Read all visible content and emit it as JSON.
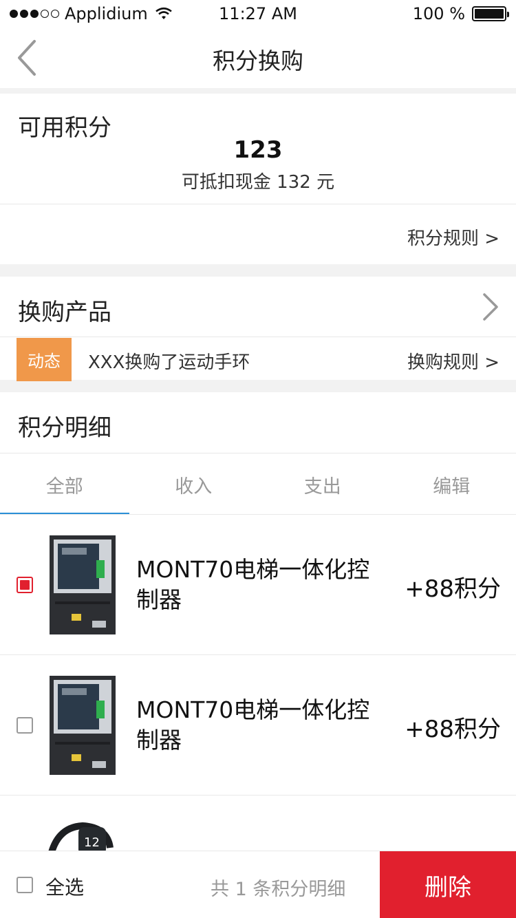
{
  "status_bar": {
    "carrier": "Applidium",
    "time": "11:27 AM",
    "battery": "100 %"
  },
  "nav": {
    "title": "积分换购"
  },
  "points": {
    "label": "可用积分",
    "value": "123",
    "cash_text": "可抵扣现金 132 元",
    "rules_link": "积分规则 >"
  },
  "exchange": {
    "title": "换购产品",
    "feed_badge": "动态",
    "feed_text": "XXX换购了运动手环",
    "rules_link": "换购规则 >"
  },
  "detail": {
    "title": "积分明细",
    "tabs": [
      {
        "label": "全部"
      },
      {
        "label": "收入"
      },
      {
        "label": "支出"
      },
      {
        "label": "编辑"
      }
    ]
  },
  "list": [
    {
      "name": "MONT70电梯一体化控制器",
      "points": "+88积分",
      "checked": true
    },
    {
      "name": "MONT70电梯一体化控制器",
      "points": "+88积分",
      "checked": false
    }
  ],
  "bottom_bar": {
    "select_all": "全选",
    "total_text": "共 1 条积分明细",
    "delete_label": "删除"
  },
  "colors": {
    "accent_red": "#e1202e",
    "badge_orange": "#f0984a",
    "tab_underline": "#2a8fd6"
  }
}
